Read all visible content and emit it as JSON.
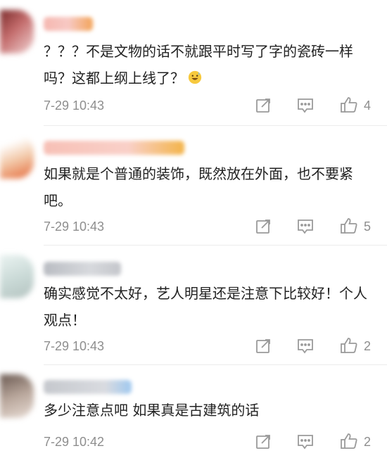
{
  "comments": [
    {
      "text": "？？？不是文物的话不就跟平时写了字的瓷砖一样吗？这都上纲上线了？",
      "emoji": "grinning-sweat-emoji",
      "time": "7-29 10:43",
      "likes": "4"
    },
    {
      "text": "如果就是个普通的装饰，既然放在外面，也不要紧吧。",
      "time": "7-29 10:43",
      "likes": "5"
    },
    {
      "text": "确实感觉不太好，艺人明星还是注意下比较好！个人观点！",
      "time": "7-29 10:43",
      "likes": "2"
    },
    {
      "text": "多少注意点吧 如果真是古建筑的话",
      "time": "7-29 10:42",
      "likes": "2"
    }
  ],
  "colors": {
    "text": "#222222",
    "meta": "#8e8e8e",
    "icon": "#9a9a9a",
    "divider": "#ececec"
  },
  "icons": [
    "forward-icon",
    "comment-icon",
    "like-icon"
  ]
}
